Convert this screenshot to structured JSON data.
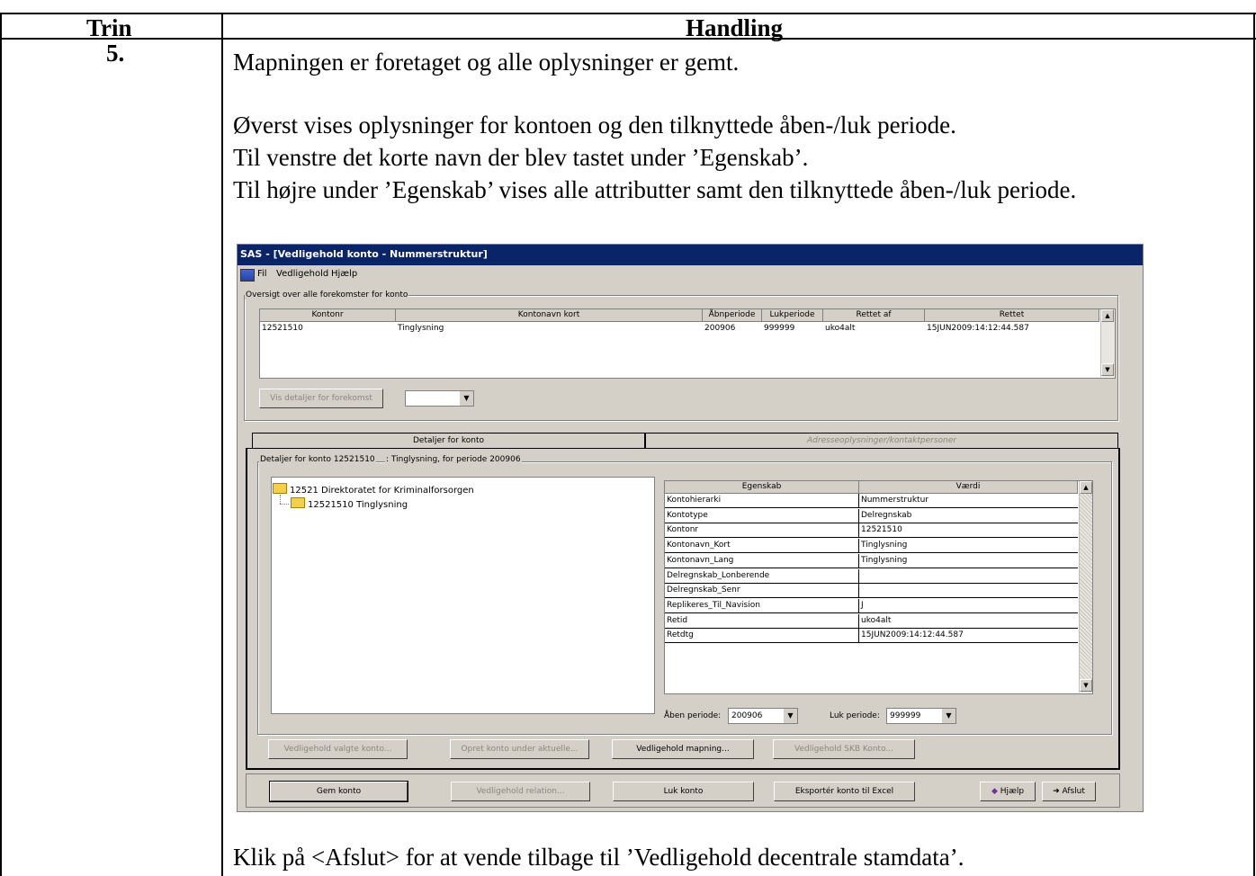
{
  "table": {
    "col1": "Trin",
    "col2": "Handling",
    "step": "5.",
    "para1": "Mapningen er foretaget og alle oplysninger er gemt.",
    "para2": "Øverst vises oplysninger for kontoen og den tilknyttede åben-/luk periode.",
    "para3": "Til venstre det korte navn der blev tastet under ’Egenskab’.",
    "para4": "Til højre under ’Egenskab’ vises alle attributter samt den tilknyttede åben-/luk periode.",
    "para5": "Klik på <Afslut> for at vende tilbage til ’Vedligehold decentrale stamdata’."
  },
  "window": {
    "title": "SAS - [Vedligehold konto - Nummerstruktur]",
    "menu": [
      "Fil",
      "Vedligehold",
      "Hjælp"
    ]
  },
  "overview": {
    "label": "Oversigt over alle forekomster for konto",
    "headers": [
      "Kontonr",
      "Kontonavn kort",
      "Åbnperiode",
      "Lukperiode",
      "Rettet af",
      "Rettet"
    ],
    "row": [
      "12521510",
      "Tinglysning",
      "200906",
      "999999",
      "uko4alt",
      "15JUN2009:14:12:44.587"
    ],
    "details_button": "Vis detaljer for forekomst",
    "combo_value": ""
  },
  "tabs": [
    "Detaljer for konto",
    "Adresseoplysninger/kontaktpersoner"
  ],
  "details": {
    "label_left": "Detaljer for konto 12521510",
    "label_right": ": Tinglysning, for periode 200906",
    "tree": [
      "12521 Direktoratet for Kriminalforsorgen",
      "12521510 Tinglysning"
    ],
    "prop_headers": [
      "Egenskab",
      "Værdi"
    ],
    "props": [
      [
        "Kontohierarki",
        "Nummerstruktur"
      ],
      [
        "Kontotype",
        "Delregnskab"
      ],
      [
        "Kontonr",
        "12521510"
      ],
      [
        "Kontonavn_Kort",
        "Tinglysning"
      ],
      [
        "Kontonavn_Lang",
        "Tinglysning"
      ],
      [
        "Delregnskab_Lonberende",
        ""
      ],
      [
        "Delregnskab_Senr",
        ""
      ],
      [
        "Replikeres_Til_Navision",
        "J"
      ],
      [
        "Retid",
        "uko4alt"
      ],
      [
        "Retdtg",
        "15JUN2009:14:12:44.587"
      ]
    ],
    "aaben_label": "Åben periode:",
    "aaben_value": "200906",
    "luk_label": "Luk periode:",
    "luk_value": "999999"
  },
  "buttons_row1": [
    "Vedligehold valgte konto...",
    "Opret konto under aktuelle...",
    "Vedligehold mapning...",
    "Vedligehold SKB Konto..."
  ],
  "buttons_row2": [
    "Gem konto",
    "Vedligehold relation...",
    "Luk konto",
    "Eksportér konto til Excel",
    "Hjælp",
    "Afslut"
  ]
}
